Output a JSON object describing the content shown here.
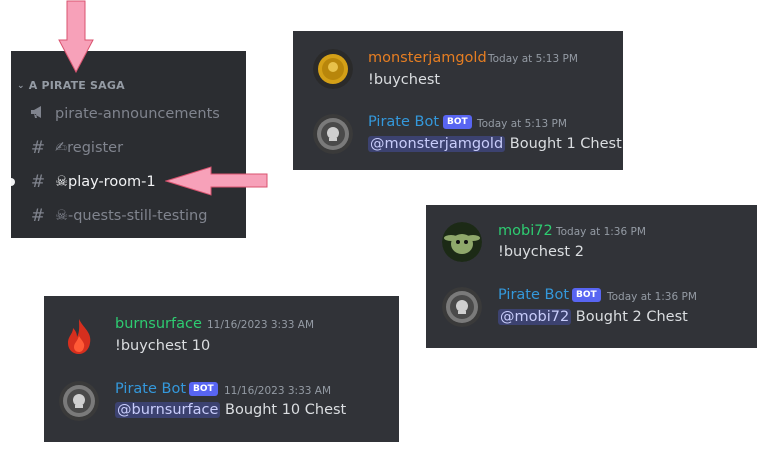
{
  "sidebar": {
    "category": "A PIRATE SAGA",
    "channels": [
      {
        "label": "pirate-announcements",
        "icon": "megaphone-icon"
      },
      {
        "label": "✍register",
        "icon": "hash-icon"
      },
      {
        "label": "☠play-room-1",
        "icon": "hash-icon",
        "active": true
      },
      {
        "label": "☠-quests-still-testing",
        "icon": "hash-icon"
      }
    ]
  },
  "chat1": {
    "user": {
      "name": "monsterjamgold",
      "time": "Today at 5:13 PM",
      "text": "!buychest",
      "color": "#e67e22"
    },
    "bot": {
      "name": "Pirate Bot",
      "badge": "BOT",
      "time": "Today at 5:13 PM",
      "mention": "@monsterjamgold",
      "text": " Bought 1 Chest",
      "color": "#3498db"
    }
  },
  "chat2": {
    "user": {
      "name": "mobi72",
      "time": "Today at 1:36 PM",
      "text": "!buychest 2",
      "color": "#2ecc71"
    },
    "bot": {
      "name": "Pirate Bot",
      "badge": "BOT",
      "time": "Today at 1:36 PM",
      "mention": "@mobi72",
      "text": " Bought 2 Chest",
      "color": "#3498db"
    }
  },
  "chat3": {
    "user": {
      "name": "burnsurface",
      "time": "11/16/2023 3:33 AM",
      "text": "!buychest 10",
      "color": "#2ecc71"
    },
    "bot": {
      "name": "Pirate Bot",
      "badge": "BOT",
      "time": "11/16/2023 3:33 AM",
      "mention": "@burnsurface",
      "text": " Bought 10 Chest",
      "color": "#3498db"
    }
  },
  "annotations": {
    "arrow_color": "#f7a1b9"
  }
}
